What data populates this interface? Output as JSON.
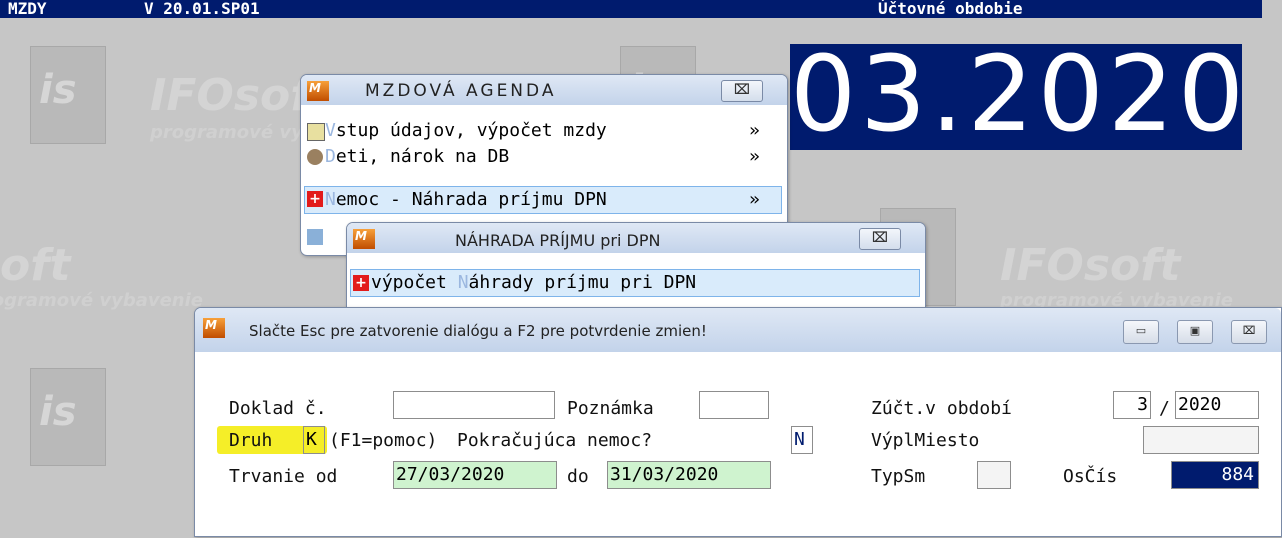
{
  "topbar": {
    "app": "MZDY",
    "version": "V 20.01.SP01",
    "period_label": "Účtovné obdobie"
  },
  "period": {
    "value": "03.2020"
  },
  "watermark": {
    "brand": "IFOsoft",
    "tagline": "programové vybavenie",
    "logo": "is"
  },
  "menu_mzdova": {
    "title": "MZDOVÁ AGENDA",
    "close": "⌧",
    "items": [
      {
        "hot": "V",
        "label": "stup údajov, výpočet mzdy",
        "arrow": "»",
        "icon": "edit-icon"
      },
      {
        "hot": "D",
        "label": "eti, nárok na DB",
        "arrow": "»",
        "icon": "children-icon"
      },
      {
        "hot": "N",
        "label": "emoc - Náhrada príjmu DPN",
        "arrow": "»",
        "icon": "red-cross-icon"
      }
    ]
  },
  "menu_nahrada": {
    "title": "NÁHRADA PRÍJMU pri DPN",
    "close": "⌧",
    "items": [
      {
        "pre": "výpočet ",
        "hot": "N",
        "label": "áhrady príjmu pri DPN",
        "icon": "red-cross-icon"
      }
    ]
  },
  "dialog": {
    "title": "Slačte Esc pre zatvorenie dialógu a F2 pre potvrdenie zmien!",
    "btn_min": "▭",
    "btn_max": "▣",
    "btn_close": "⌧",
    "doklad_label": "Doklad č.",
    "doklad_value": "",
    "poznamka_label": "Poznámka",
    "poznamka_value": "",
    "zuct_label": "Zúčt.v období",
    "zuct_month": "3",
    "zuct_sep": "/",
    "zuct_year": "2020",
    "druh_label": "Druh",
    "druh_value": "K",
    "druh_help": "(F1=pomoc)",
    "pokracujuca_label": "Pokračujúca nemoc?",
    "pokracujuca_value": "N",
    "vyplmiesto_label": "VýplMiesto",
    "vyplmiesto_value": "",
    "trvanie_label": "Trvanie od",
    "trvanie_od": "27/03/2020",
    "do_label": "do",
    "trvanie_do": "31/03/2020",
    "typsm_label": "TypSm",
    "typsm_value": "",
    "oscis_label": "OsČís",
    "oscis_value": "884"
  }
}
